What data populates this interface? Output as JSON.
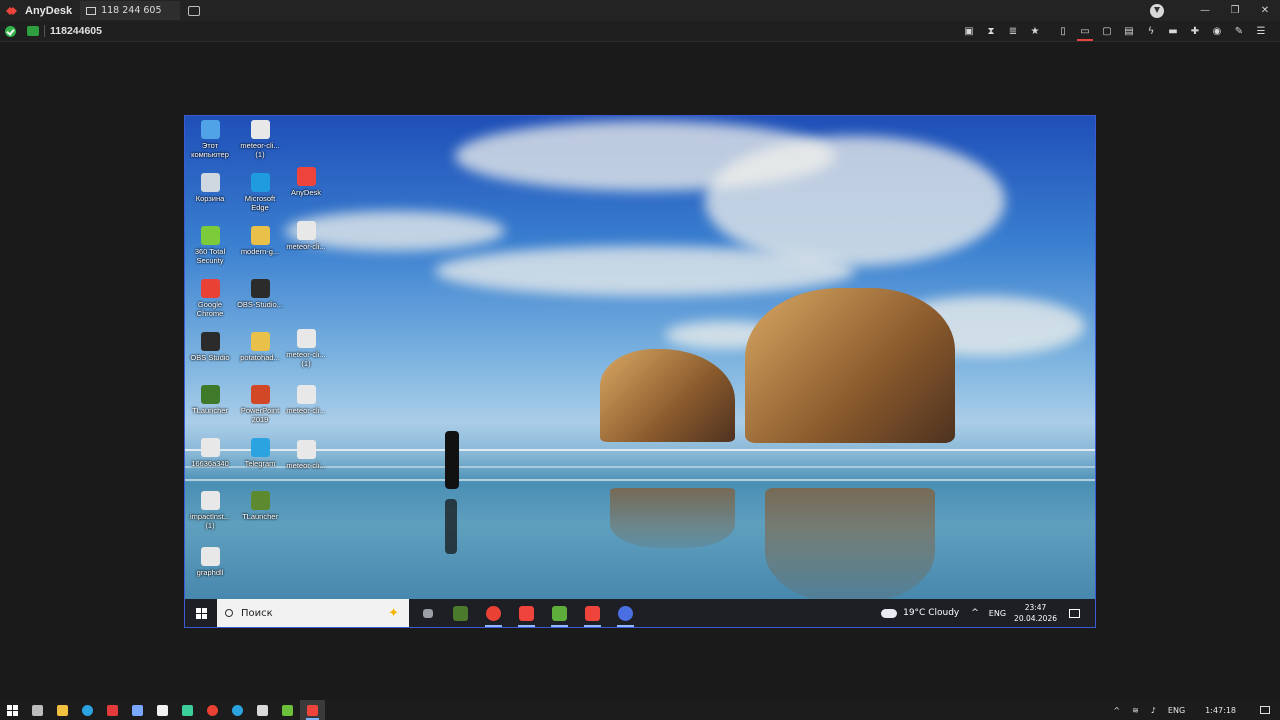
{
  "window": {
    "app_name": "AnyDesk",
    "tab_label": "118 244 605",
    "controls": [
      "—",
      "❐",
      "✕"
    ]
  },
  "session": {
    "remote_id": "118244605",
    "tools": [
      "screenshot-icon",
      "hourglass-icon",
      "database-icon",
      "star-icon",
      "file-icon",
      "display-icon",
      "chat-icon",
      "message-icon",
      "lightning-icon",
      "keyboard-icon",
      "puzzle-icon",
      "record-icon",
      "pen-icon",
      "menu-icon"
    ]
  },
  "remote_desktop": {
    "icons": [
      {
        "label": "Этот компьютер",
        "color": "#4fa3e6"
      },
      {
        "label": "meteor-cli... (1)",
        "color": "#e8e8e8"
      },
      {
        "label": "Корзина",
        "color": "#cfd8e0"
      },
      {
        "label": "Microsoft Edge",
        "color": "#1f9be0"
      },
      {
        "label": "AnyDesk",
        "color": "#ef443b"
      },
      {
        "label": "360 Total Security",
        "color": "#7ccb3a"
      },
      {
        "label": "modern-g...",
        "color": "#e8c04a"
      },
      {
        "label": "meteor-cli...",
        "color": "#e8e8e8"
      },
      {
        "label": "Google Chrome",
        "color": "#e94235"
      },
      {
        "label": "OBS-Studio...",
        "color": "#2b2b2b"
      },
      {
        "label": "OBS Studio",
        "color": "#2b2b2b"
      },
      {
        "label": "potatohad...",
        "color": "#e8c04a"
      },
      {
        "label": "meteor-cli... (1)",
        "color": "#e8e8e8"
      },
      {
        "label": "TLauncher",
        "color": "#3f7a2a"
      },
      {
        "label": "PowerPoint 2019",
        "color": "#d24726"
      },
      {
        "label": "meteor-cli...",
        "color": "#e8e8e8"
      },
      {
        "label": "16636a340",
        "color": "#e8e8e8"
      },
      {
        "label": "Telegram",
        "color": "#2aa3e0"
      },
      {
        "label": "meteor-cli...",
        "color": "#e8e8e8"
      },
      {
        "label": "impactlnst... (1)",
        "color": "#e8e8e8"
      },
      {
        "label": "TLauncher",
        "color": "#5d8a2e"
      },
      {
        "label": "graphdll",
        "color": "#e8e8e8"
      }
    ],
    "taskbar": {
      "search_placeholder": "Поиск",
      "apps": [
        {
          "name": "task-view-icon",
          "color": "#9aa0a6"
        },
        {
          "name": "minecraft-icon",
          "color": "#4b7a2d"
        },
        {
          "name": "chrome-icon",
          "color": "#e94235"
        },
        {
          "name": "anydesk-icon",
          "color": "#ef443b"
        },
        {
          "name": "tlauncher-icon",
          "color": "#5fae3c"
        },
        {
          "name": "anydesk-icon",
          "color": "#ef443b"
        },
        {
          "name": "app-icon",
          "color": "#4a6fe3"
        }
      ],
      "weather": "19°C  Cloudy",
      "lang": "ENG",
      "time": "23:47",
      "date": "20.04.2026"
    }
  },
  "host_taskbar": {
    "apps": [
      {
        "name": "task-view-icon",
        "color": "#bdbdbd"
      },
      {
        "name": "explorer-icon",
        "color": "#f0c040"
      },
      {
        "name": "telegram-icon",
        "color": "#2aa3e0"
      },
      {
        "name": "wps-icon",
        "color": "#e33b3b"
      },
      {
        "name": "app-icon",
        "color": "#7aa7ff"
      },
      {
        "name": "store-icon",
        "color": "#f2f2f2"
      },
      {
        "name": "app-icon",
        "color": "#3ccf9a"
      },
      {
        "name": "chrome-icon",
        "color": "#e94235"
      },
      {
        "name": "telegram-icon",
        "color": "#2aa3e0"
      },
      {
        "name": "app-icon",
        "color": "#d9d9d9"
      },
      {
        "name": "minecraft-icon",
        "color": "#6bbf3a"
      },
      {
        "name": "anydesk-icon",
        "color": "#ef443b"
      }
    ],
    "lang": "ENG",
    "time": "1:47:18"
  }
}
